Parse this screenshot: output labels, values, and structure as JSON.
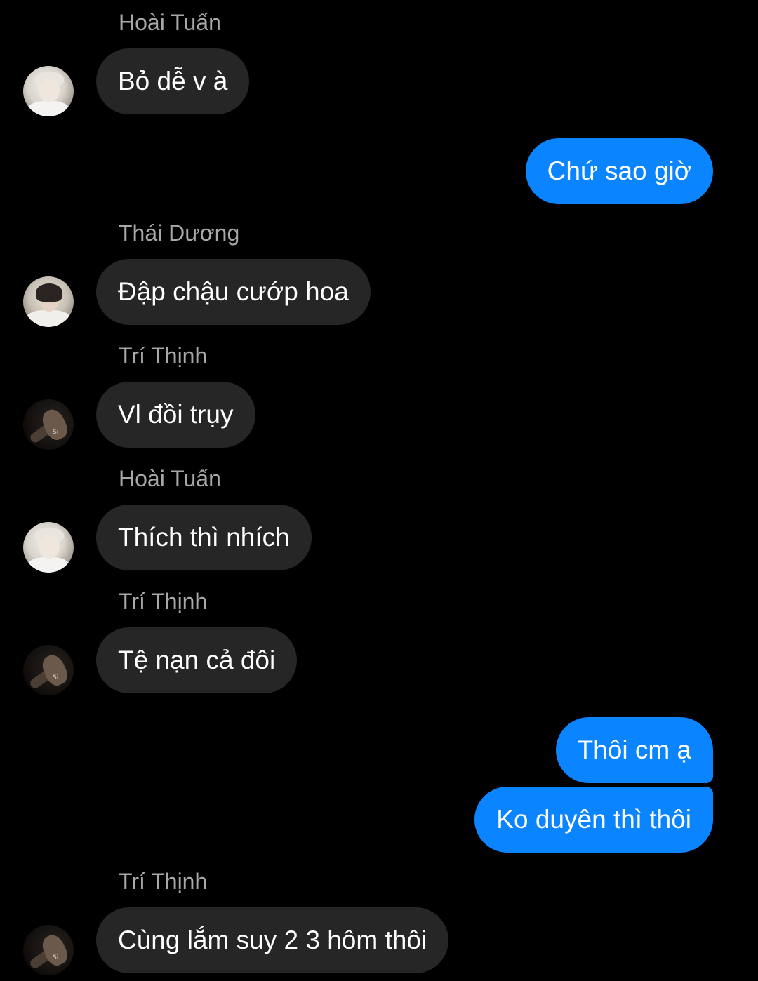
{
  "messages": [
    {
      "type": "in",
      "sender": "Hoài Tuấn",
      "text": "Bỏ dễ v à",
      "avatar": "avatar-hoai-tuan"
    },
    {
      "type": "out",
      "text": "Chứ sao giờ"
    },
    {
      "type": "in",
      "sender": "Thái Dương",
      "text": "Đập chậu cướp hoa",
      "avatar": "avatar-thai-duong"
    },
    {
      "type": "in",
      "sender": "Trí Thịnh",
      "text": "Vl đồi trụy",
      "avatar": "avatar-tri-thinh"
    },
    {
      "type": "in",
      "sender": "Hoài Tuấn",
      "text": "Thích thì nhích",
      "avatar": "avatar-hoai-tuan"
    },
    {
      "type": "in",
      "sender": "Trí Thịnh",
      "text": "Tệ nạn cả đôi",
      "avatar": "avatar-tri-thinh"
    },
    {
      "type": "out",
      "text": "Thôi cm ạ"
    },
    {
      "type": "out",
      "text": "Ko duyên thì thôi"
    },
    {
      "type": "in",
      "sender": "Trí Thịnh",
      "text": "Cùng lắm suy 2 3 hôm thôi",
      "avatar": "avatar-tri-thinh"
    }
  ],
  "avatar_mark": "Si",
  "colors": {
    "background": "#000000",
    "incoming_bubble": "#262626",
    "outgoing_bubble": "#0a84ff",
    "sender_name": "#a8a8a8",
    "message_text": "#ffffff"
  }
}
